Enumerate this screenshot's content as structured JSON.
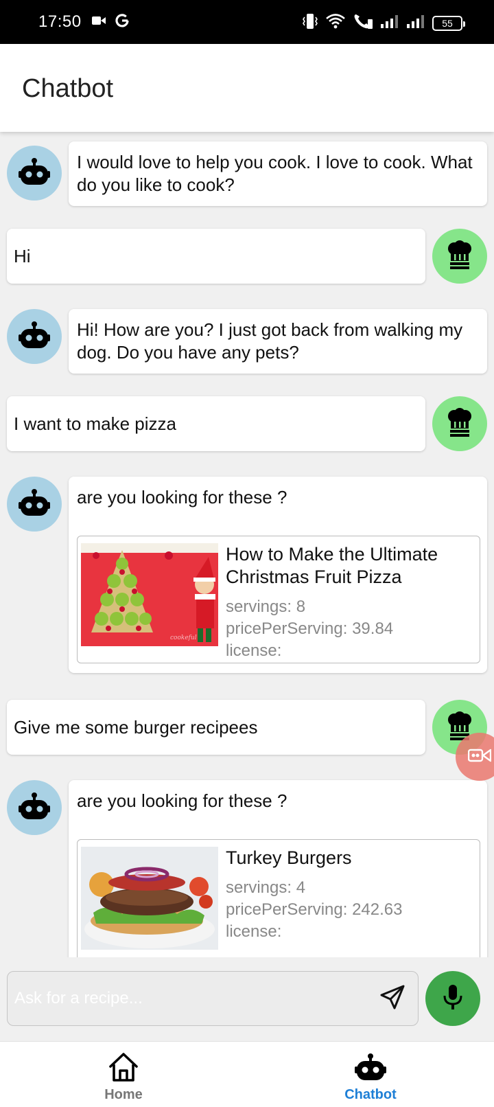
{
  "status_bar": {
    "time": "17:50",
    "battery": "55",
    "icons": [
      "video-camera-icon",
      "google-icon",
      "vibrate-icon",
      "wifi-icon",
      "wifi-calling-icon",
      "signal-icon",
      "signal-icon"
    ]
  },
  "header": {
    "title": "Chatbot"
  },
  "messages": [
    {
      "sender": "bot",
      "text": " I would love to help you cook. I love to cook. What do you like to cook?"
    },
    {
      "sender": "user",
      "text": "Hi"
    },
    {
      "sender": "bot",
      "text": " Hi! How are you? I just got back from walking my dog. Do you have any pets?"
    },
    {
      "sender": "user",
      "text": "I want to make pizza"
    },
    {
      "sender": "bot",
      "text": "are you looking for these ?",
      "recipe": {
        "title": "How to Make the Ultimate Christmas Fruit Pizza",
        "servings": "servings: 8",
        "price": "pricePerServing: 39.84",
        "license": "license:",
        "image_watermark": "cookeful"
      }
    },
    {
      "sender": "user",
      "text": "Give me some burger recipees"
    },
    {
      "sender": "bot",
      "text": "are you looking for these ?",
      "recipe": {
        "title": "Turkey Burgers",
        "servings": "servings: 4",
        "price": "pricePerServing: 242.63",
        "license": "license:"
      }
    }
  ],
  "input": {
    "placeholder": "Ask for a recipe..."
  },
  "nav": {
    "home_label": "Home",
    "chatbot_label": "Chatbot"
  },
  "colors": {
    "bot_avatar": "#a9d1e4",
    "user_avatar": "#86e58a",
    "mic_button": "#3ea64a",
    "nav_active": "#1e7fd6",
    "floating_button": "#ea786e"
  }
}
